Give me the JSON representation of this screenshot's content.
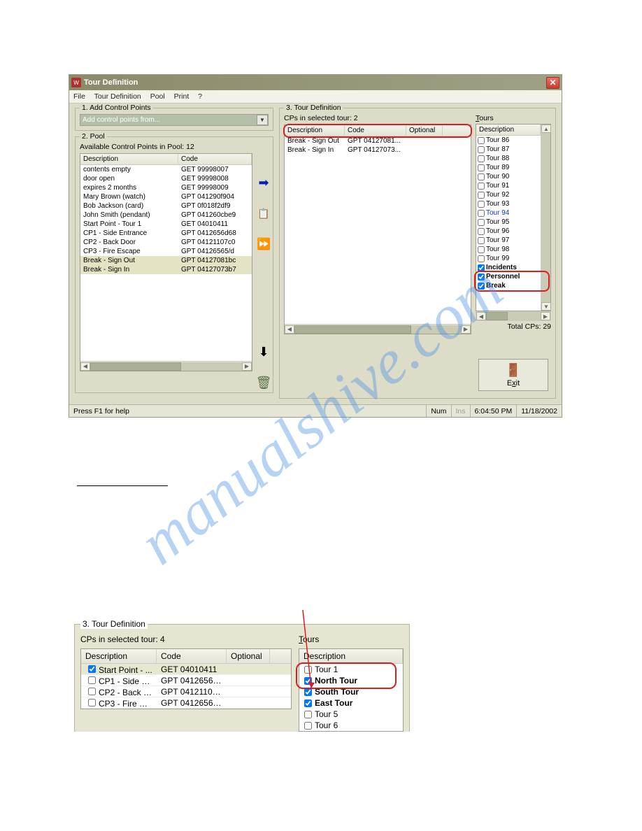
{
  "watermark": "manualshive.com",
  "window": {
    "title": "Tour Definition",
    "close_icon": "✕"
  },
  "menu": {
    "file": "File",
    "tour_definition": "Tour Definition",
    "pool": "Pool",
    "print": "Print",
    "help": "?"
  },
  "section1": {
    "title": "1. Add Control Points",
    "combo_text": "Add control points from..."
  },
  "section2": {
    "title": "2. Pool",
    "available_label": "Available Control Points in Pool: 12",
    "headers": {
      "desc": "Description",
      "code": "Code"
    },
    "rows": [
      {
        "desc": "contents empty",
        "code": "GET 99998007"
      },
      {
        "desc": "door open",
        "code": "GET 99998008"
      },
      {
        "desc": "expires 2 months",
        "code": "GET 99998009"
      },
      {
        "desc": "Mary Brown (watch)",
        "code": "GPT 041290f904"
      },
      {
        "desc": "Bob Jackson (card)",
        "code": "GPT 0f018f2df9"
      },
      {
        "desc": "John Smith (pendant)",
        "code": "GPT 041260cbe9"
      },
      {
        "desc": "Start Point - Tour 1",
        "code": "GET 04010411"
      },
      {
        "desc": "CP1 - Side Entrance",
        "code": "GPT 0412656d68"
      },
      {
        "desc": "CP2 - Back Door",
        "code": "GPT 04121107c0"
      },
      {
        "desc": "CP3 - Fire Escape",
        "code": "GPT 04126565/d"
      },
      {
        "desc": "Break - Sign Out",
        "code": "GPT 04127081bc"
      },
      {
        "desc": "Break - Sign In",
        "code": "GPT 04127073b7"
      }
    ]
  },
  "section3": {
    "title": "3. Tour Definition",
    "cps_label": "CPs in selected tour: 2",
    "headers": {
      "desc": "Description",
      "code": "Code",
      "opt": "Optional"
    },
    "rows": [
      {
        "desc": "Break - Sign Out",
        "code": "GPT 04127081...",
        "opt": ""
      },
      {
        "desc": "Break - Sign In",
        "code": "GPT 04127073...",
        "opt": ""
      }
    ],
    "tours_label": "Tours",
    "tours_header": "Description",
    "tours": [
      {
        "label": "Tour 86",
        "checked": false,
        "bold": false
      },
      {
        "label": "Tour 87",
        "checked": false,
        "bold": false
      },
      {
        "label": "Tour 88",
        "checked": false,
        "bold": false
      },
      {
        "label": "Tour 89",
        "checked": false,
        "bold": false
      },
      {
        "label": "Tour 90",
        "checked": false,
        "bold": false
      },
      {
        "label": "Tour 91",
        "checked": false,
        "bold": false
      },
      {
        "label": "Tour 92",
        "checked": false,
        "bold": false
      },
      {
        "label": "Tour 93",
        "checked": false,
        "bold": false
      },
      {
        "label": "Tour 94",
        "checked": false,
        "bold": false,
        "special": true
      },
      {
        "label": "Tour 95",
        "checked": false,
        "bold": false
      },
      {
        "label": "Tour 96",
        "checked": false,
        "bold": false
      },
      {
        "label": "Tour 97",
        "checked": false,
        "bold": false
      },
      {
        "label": "Tour 98",
        "checked": false,
        "bold": false
      },
      {
        "label": "Tour 99",
        "checked": false,
        "bold": false
      },
      {
        "label": "Incidents",
        "checked": true,
        "bold": true
      },
      {
        "label": "Personnel",
        "checked": true,
        "bold": true
      },
      {
        "label": "Break",
        "checked": true,
        "bold": true
      }
    ],
    "total_cps": "Total CPs: 29"
  },
  "exit_label": "Exit",
  "status": {
    "help": "Press F1 for help",
    "num": "Num",
    "ins": "Ins",
    "time": "6:04:50 PM",
    "date": "11/18/2002"
  },
  "lower": {
    "section_title": "3. Tour Definition",
    "cps_label": "CPs in selected tour: 4",
    "headers": {
      "desc": "Description",
      "code": "Code",
      "opt": "Optional"
    },
    "rows": [
      {
        "desc": "Start Point - ...",
        "code": "GET 04010411",
        "checked": true
      },
      {
        "desc": "CP1 - Side E...",
        "code": "GPT 0412656d...",
        "checked": false
      },
      {
        "desc": "CP2 - Back D...",
        "code": "GPT 04121107...",
        "checked": false
      },
      {
        "desc": "CP3 - Fire Es...",
        "code": "GPT 04126565...",
        "checked": false
      }
    ],
    "tours_label": "Tours",
    "tours_header": "Description",
    "tours": [
      {
        "label": "Tour 1",
        "checked": false,
        "bold": false
      },
      {
        "label": "North Tour",
        "checked": true,
        "bold": true
      },
      {
        "label": "South Tour",
        "checked": true,
        "bold": true
      },
      {
        "label": "East Tour",
        "checked": true,
        "bold": true
      },
      {
        "label": "Tour 5",
        "checked": false,
        "bold": false
      },
      {
        "label": "Tour 6",
        "checked": false,
        "bold": false
      }
    ]
  }
}
